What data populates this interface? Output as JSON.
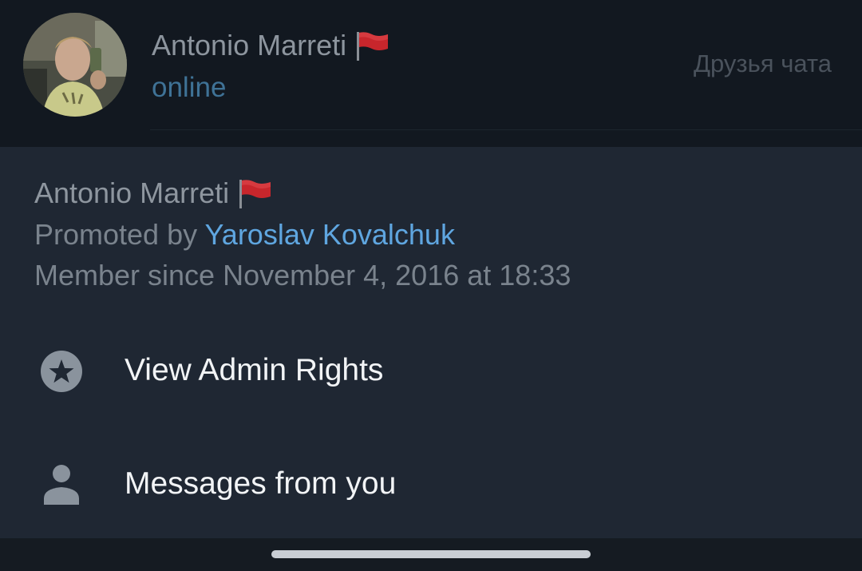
{
  "background_row": {
    "name": "Antonio Marreti",
    "flag_icon": "red-flag-icon",
    "status": "online",
    "role": "Друзья чата"
  },
  "sheet": {
    "name": "Antonio Marreti",
    "flag_icon": "red-flag-icon",
    "promoted_prefix": "Promoted by ",
    "promoted_by": "Yaroslav Kovalchuk",
    "member_since": "Member since November 4, 2016 at 18:33",
    "items": [
      {
        "icon": "star-icon",
        "label": "View Admin Rights"
      },
      {
        "icon": "person-icon",
        "label": "Messages from you"
      }
    ]
  },
  "colors": {
    "sheet_background": "#1f2733",
    "link": "#5fa6e0",
    "status_online": "#3f7296",
    "flag": "#e0242b"
  }
}
